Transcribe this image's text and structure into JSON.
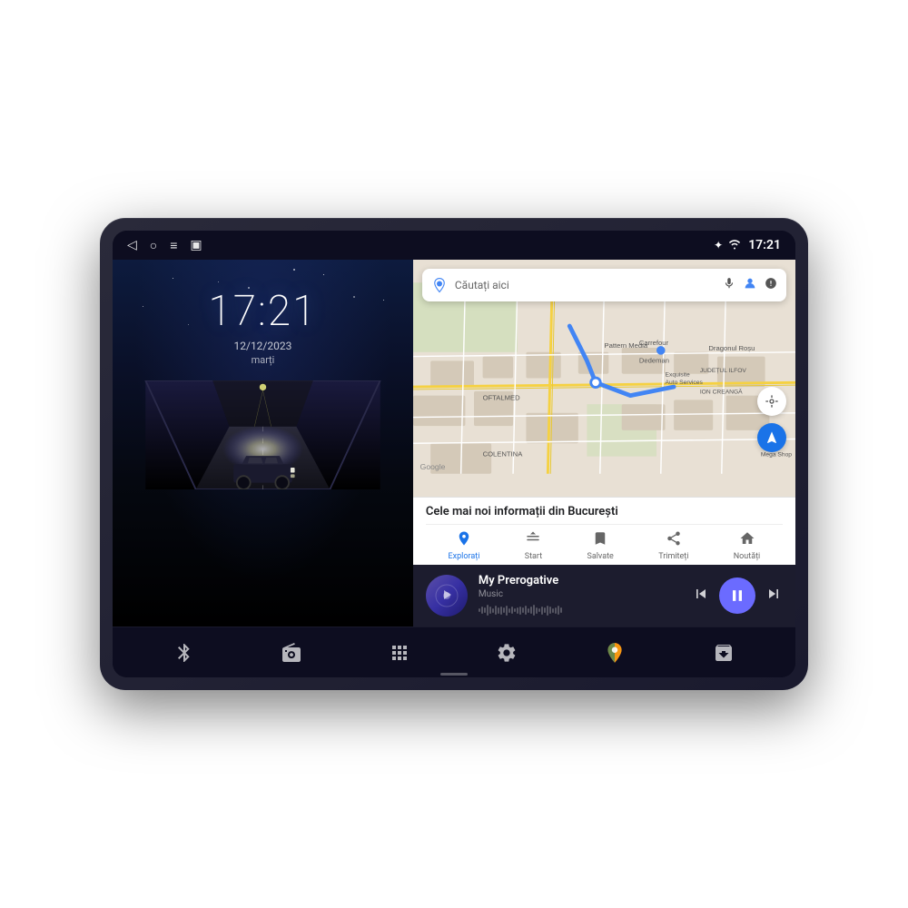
{
  "device": {
    "status_bar": {
      "back_icon": "◁",
      "circle_icon": "○",
      "menu_icon": "≡",
      "screenshot_icon": "▣",
      "bluetooth_icon": "✦",
      "wifi_icon": "▲",
      "time": "17:21"
    },
    "left_panel": {
      "time": "17:21",
      "date": "12/12/2023",
      "day": "marți"
    },
    "map": {
      "search_placeholder": "Căutați aici",
      "info_title": "Cele mai noi informații din București",
      "tabs": [
        {
          "label": "Explorați",
          "active": true
        },
        {
          "label": "Start",
          "active": false
        },
        {
          "label": "Salvate",
          "active": false
        },
        {
          "label": "Trimiteți",
          "active": false
        },
        {
          "label": "Noutăți",
          "active": false
        }
      ]
    },
    "music": {
      "title": "My Prerogative",
      "subtitle": "Music",
      "controls": {
        "prev": "⏮",
        "play": "⏸",
        "next": "⏭"
      }
    },
    "bottom_nav": {
      "items": [
        {
          "icon": "bluetooth",
          "label": "Bluetooth"
        },
        {
          "icon": "radio",
          "label": "Radio"
        },
        {
          "icon": "apps",
          "label": "Apps"
        },
        {
          "icon": "settings",
          "label": "Settings"
        },
        {
          "icon": "maps",
          "label": "Maps"
        },
        {
          "icon": "box",
          "label": "Box"
        }
      ]
    }
  }
}
